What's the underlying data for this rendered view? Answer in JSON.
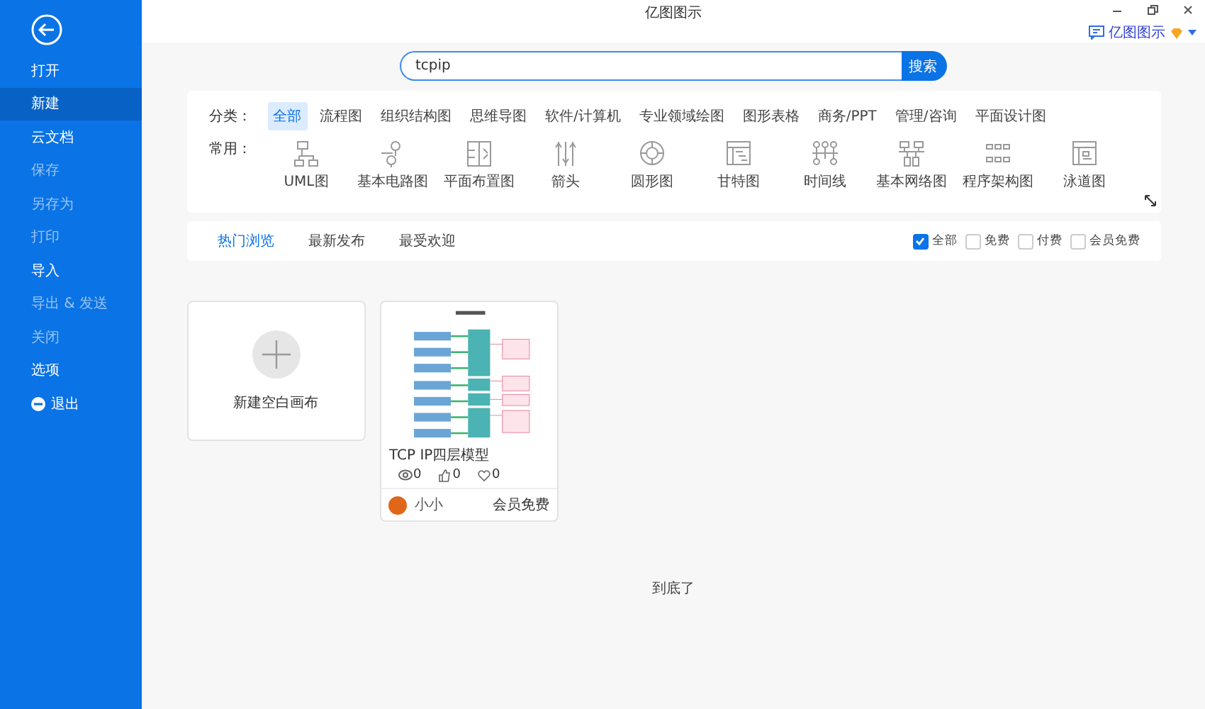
{
  "window": {
    "title": "亿图图示"
  },
  "account": {
    "name": "亿图图示"
  },
  "sidebar": {
    "items": [
      {
        "label": "打开",
        "selected": false,
        "disabled": false,
        "kind": "plain"
      },
      {
        "label": "新建",
        "selected": true,
        "disabled": false,
        "kind": "plain"
      },
      {
        "label": "云文档",
        "selected": false,
        "disabled": false,
        "kind": "plain"
      },
      {
        "label": "保存",
        "selected": false,
        "disabled": true,
        "kind": "plain"
      },
      {
        "label": "另存为",
        "selected": false,
        "disabled": true,
        "kind": "plain"
      },
      {
        "label": "打印",
        "selected": false,
        "disabled": true,
        "kind": "plain"
      },
      {
        "label": "导入",
        "selected": false,
        "disabled": false,
        "kind": "plain"
      },
      {
        "label": "导出 & 发送",
        "selected": false,
        "disabled": true,
        "kind": "plain"
      },
      {
        "label": "关闭",
        "selected": false,
        "disabled": true,
        "kind": "plain"
      },
      {
        "label": "选项",
        "selected": false,
        "disabled": false,
        "kind": "plain"
      },
      {
        "label": "退出",
        "selected": false,
        "disabled": false,
        "kind": "exit"
      }
    ]
  },
  "search": {
    "value": "tcpip",
    "button": "搜索"
  },
  "categories": {
    "label": "分类：",
    "items": [
      {
        "label": "全部",
        "selected": true
      },
      {
        "label": "流程图",
        "selected": false
      },
      {
        "label": "组织结构图",
        "selected": false
      },
      {
        "label": "思维导图",
        "selected": false
      },
      {
        "label": "软件/计算机",
        "selected": false
      },
      {
        "label": "专业领域绘图",
        "selected": false
      },
      {
        "label": "图形表格",
        "selected": false
      },
      {
        "label": "商务/PPT",
        "selected": false
      },
      {
        "label": "管理/咨询",
        "selected": false
      },
      {
        "label": "平面设计图",
        "selected": false
      }
    ]
  },
  "common": {
    "label": "常用：",
    "items": [
      {
        "label": "UML图",
        "kind": "uml"
      },
      {
        "label": "基本电路图",
        "kind": "circuit"
      },
      {
        "label": "平面布置图",
        "kind": "floor"
      },
      {
        "label": "箭头",
        "kind": "arrows"
      },
      {
        "label": "圆形图",
        "kind": "circle"
      },
      {
        "label": "甘特图",
        "kind": "gantt"
      },
      {
        "label": "时间线",
        "kind": "timeline"
      },
      {
        "label": "基本网络图",
        "kind": "network"
      },
      {
        "label": "程序架构图",
        "kind": "program"
      },
      {
        "label": "泳道图",
        "kind": "swimlane"
      }
    ]
  },
  "sort_tabs": [
    {
      "label": "热门浏览",
      "selected": true
    },
    {
      "label": "最新发布",
      "selected": false
    },
    {
      "label": "最受欢迎",
      "selected": false
    }
  ],
  "filters": [
    {
      "label": "全部",
      "checked": true
    },
    {
      "label": "免费",
      "checked": false
    },
    {
      "label": "付费",
      "checked": false
    },
    {
      "label": "会员免费",
      "checked": false
    }
  ],
  "templates": [
    {
      "kind": "blank",
      "label": "新建空白画布"
    },
    {
      "kind": "template",
      "title": "TCP IP四层模型",
      "views": "0",
      "likes": "0",
      "favorites": "0",
      "author": "小小",
      "price": "会员免费"
    }
  ],
  "footer": "到底了"
}
